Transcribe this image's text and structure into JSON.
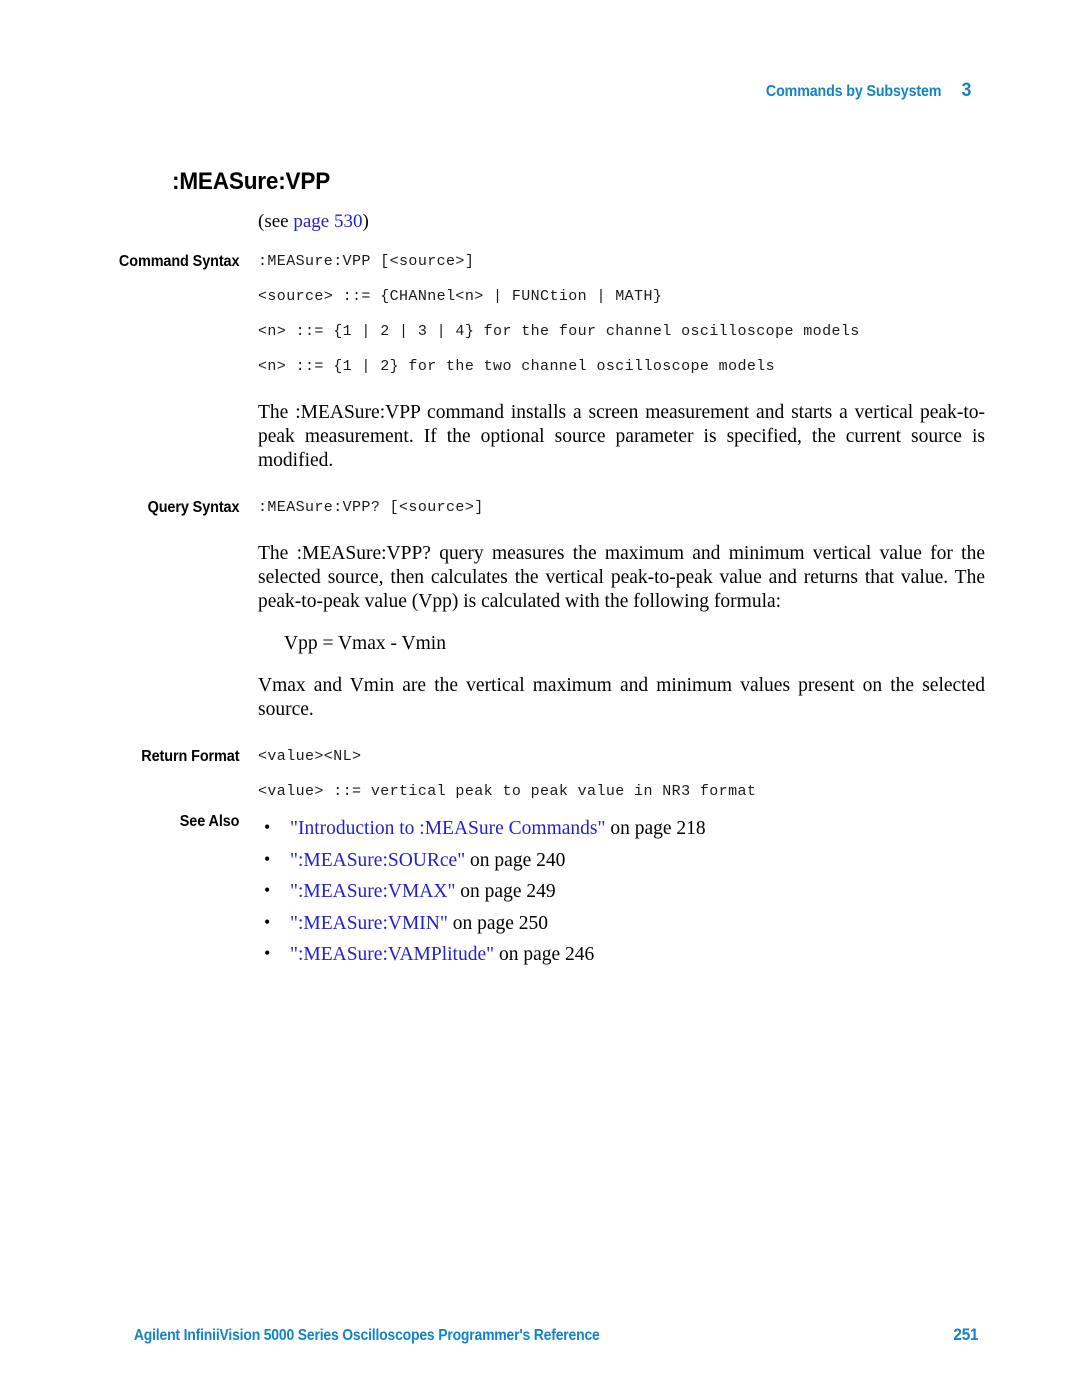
{
  "header": {
    "chapter_title": "Commands by Subsystem",
    "chapter_number": "3"
  },
  "title": ":MEASure:VPP",
  "see_reference": {
    "prefix": "(see ",
    "link": "page 530",
    "suffix": ")"
  },
  "sections": {
    "command_syntax": {
      "label": "Command Syntax",
      "code_lines": [
        ":MEASure:VPP [<source>]",
        "<source> ::= {CHANnel<n> | FUNCtion | MATH}",
        "<n> ::= {1 | 2 | 3 | 4} for the four channel oscilloscope models",
        "<n> ::= {1 | 2} for the two channel oscilloscope models"
      ],
      "paragraph": "The :MEASure:VPP command installs a screen measurement and starts a vertical peak-to-peak measurement. If the optional source parameter is specified, the current source is modified."
    },
    "query_syntax": {
      "label": "Query Syntax",
      "code_lines": [
        ":MEASure:VPP? [<source>]"
      ],
      "paragraph": "The :MEASure:VPP? query measures the maximum and minimum vertical value for the selected source, then calculates the vertical peak-to-peak value and returns that value. The peak-to-peak value (Vpp) is calculated with the following formula:",
      "formula": "Vpp = Vmax -  Vmin",
      "paragraph2": "Vmax and Vmin are the vertical maximum and minimum values present on the selected source."
    },
    "return_format": {
      "label": "Return Format",
      "code_lines": [
        "<value><NL>",
        "<value> ::= vertical peak to peak value in NR3 format"
      ]
    },
    "see_also": {
      "label": "See Also",
      "items": [
        {
          "link": "\"Introduction to :MEASure Commands\"",
          "tail": " on page 218"
        },
        {
          "link": "\":MEASure:SOURce\"",
          "tail": " on page 240"
        },
        {
          "link": "\":MEASure:VMAX\"",
          "tail": " on page 249"
        },
        {
          "link": "\":MEASure:VMIN\"",
          "tail": " on page 250"
        },
        {
          "link": "\":MEASure:VAMPlitude\"",
          "tail": " on page 246"
        }
      ]
    }
  },
  "footer": {
    "title": "Agilent InfiniiVision 5000 Series Oscilloscopes Programmer's Reference",
    "page_number": "251"
  },
  "colors": {
    "header_blue": "#1183C6",
    "link_blue": "#2222CC",
    "text_black": "#000000"
  }
}
